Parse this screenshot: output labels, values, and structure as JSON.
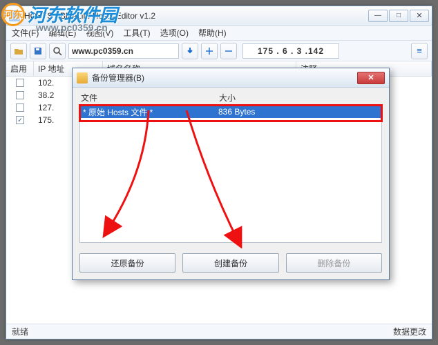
{
  "main": {
    "title": "HOSTS - BlueLife Hosts Editor v1.2",
    "menu": [
      "文件(F)",
      "编辑(E)",
      "视图(V)",
      "工具(T)",
      "选项(O)",
      "帮助(H)"
    ],
    "url_value": "www.pc0359.cn",
    "ip_value": "175 . 6 . 3 .142",
    "columns": {
      "enable": "启用",
      "ip": "IP 地址",
      "domain": "域名名称",
      "note": "注释"
    },
    "rows": [
      {
        "checked": false,
        "ip": "102."
      },
      {
        "checked": false,
        "ip": "38.2"
      },
      {
        "checked": false,
        "ip": "127."
      },
      {
        "checked": true,
        "ip": "175."
      }
    ],
    "status_left": "就绪",
    "status_right": "数据更改"
  },
  "watermark": {
    "text": "河东软件园",
    "url": "www.pc0359.cn"
  },
  "dialog": {
    "title": "备份管理器(B)",
    "col_file": "文件",
    "col_size": "大小",
    "row": {
      "file": "* 原始 Hosts 文件 *",
      "size": "836 Bytes"
    },
    "btn_restore": "还原备份",
    "btn_create": "创建备份",
    "btn_delete": "删除备份"
  }
}
